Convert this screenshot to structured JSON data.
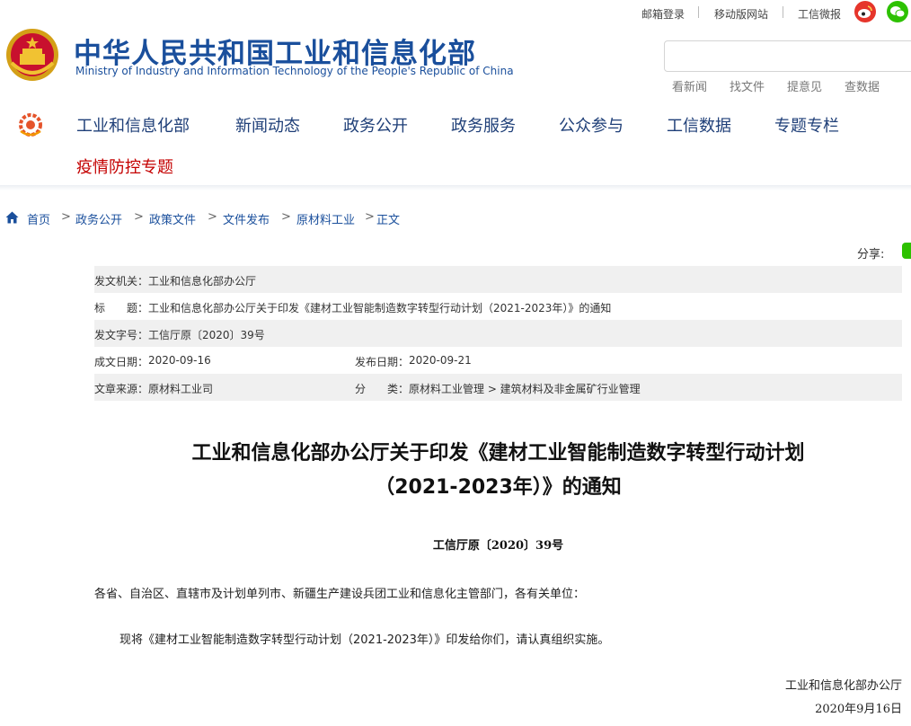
{
  "top_bar": {
    "mail_login": "邮箱登录",
    "mobile_site": "移动版网站",
    "weibo": "工信微报"
  },
  "header": {
    "title_cn": "中华人民共和国工业和信息化部",
    "title_en": "Ministry of Industry and Information Technology of the People's Republic of China",
    "search_placeholder": "",
    "quick_links": [
      "看新闻",
      "找文件",
      "提意见",
      "查数据"
    ]
  },
  "nav": {
    "items": [
      "工业和信息化部",
      "新闻动态",
      "政务公开",
      "政务服务",
      "公众参与",
      "工信数据",
      "专题专栏"
    ],
    "special": "疫情防控专题"
  },
  "breadcrumb": {
    "items": [
      "首页",
      "政务公开",
      "政策文件",
      "文件发布",
      "原材料工业",
      "正文"
    ],
    "separator": ">"
  },
  "share_label": "分享:",
  "info": {
    "issuer_label": "发文机关：",
    "issuer": "工业和信息化部办公厅",
    "title_label": "标　　题：",
    "title": "工业和信息化部办公厅关于印发《建材工业智能制造数字转型行动计划（2021-2023年）》的通知",
    "docno_label": "发文字号：",
    "docno": "工信厅原〔2020〕39号",
    "written_label": "成文日期：",
    "written": "2020-09-16",
    "published_label": "发布日期：",
    "published": "2020-09-21",
    "source_label": "文章来源：",
    "source": "原材料工业司",
    "category_label": "分　　类：",
    "category": "原材料工业管理 > 建筑材料及非金属矿行业管理"
  },
  "article": {
    "title_line1": "工业和信息化部办公厅关于印发《建材工业智能制造数字转型行动计划",
    "title_line2": "（2021-2023年）》的通知",
    "doc_number": "工信厅原〔2020〕39号",
    "salutation": "各省、自治区、直辖市及计划单列市、新疆生产建设兵团工业和信息化主管部门，各有关单位：",
    "body": "现将《建材工业智能制造数字转型行动计划（2021-2023年）》印发给你们，请认真组织实施。",
    "signature": "工业和信息化部办公厅",
    "date": "2020年9月16日"
  },
  "colors": {
    "brand_blue": "#1a4f9c",
    "nav_text": "#1f3f78",
    "highlight_red": "#c40000",
    "weibo_red": "#e6352b",
    "wechat_green": "#2dc100",
    "info_grey": "#f0f0f0"
  }
}
